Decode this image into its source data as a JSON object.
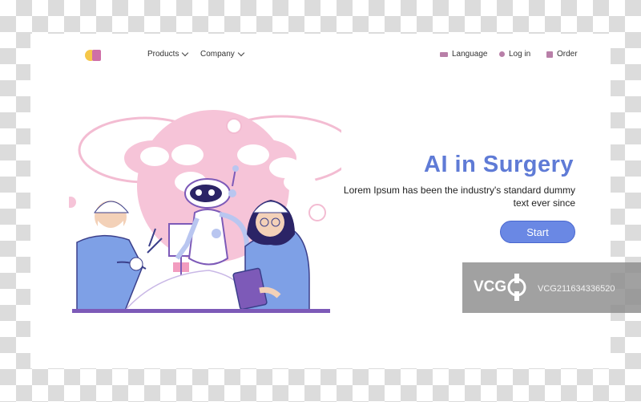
{
  "header": {
    "nav": [
      {
        "label": "Products"
      },
      {
        "label": "Company"
      }
    ],
    "right_links": [
      {
        "label": "Language",
        "icon": "globe-icon"
      },
      {
        "label": "Log in",
        "icon": "user-icon"
      },
      {
        "label": "Order",
        "icon": "cart-icon"
      }
    ]
  },
  "hero": {
    "title": "AI in Surgery",
    "description": "Lorem Ipsum has been the industry's standard dummy text ever since",
    "cta_label": "Start"
  },
  "watermark": {
    "brand": "VCG",
    "id": "VCG211634336520"
  },
  "colors": {
    "accent": "#5f7bd6",
    "button": "#6a88e4",
    "pink": "#f6c4d8",
    "purple": "#7d5ab8",
    "blue_clothes": "#7ea0e6"
  }
}
